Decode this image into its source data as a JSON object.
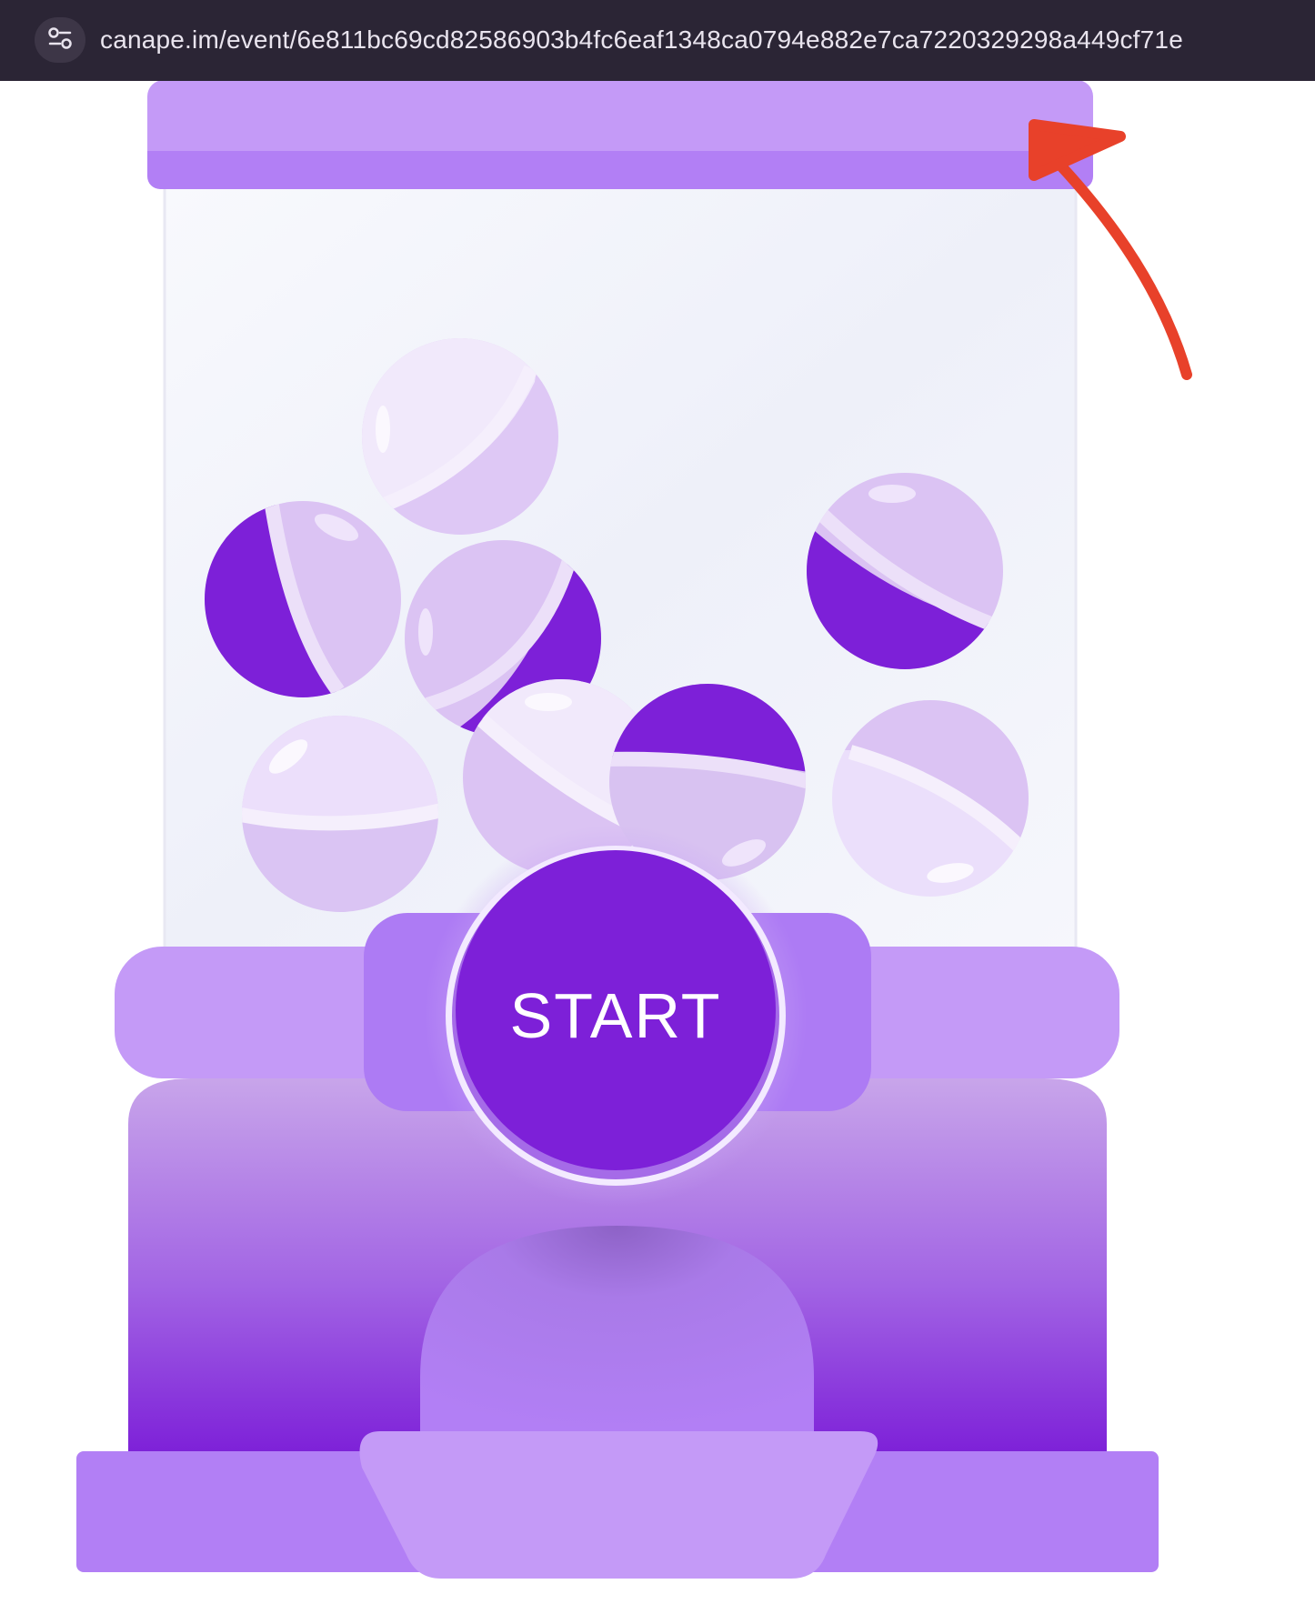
{
  "browser": {
    "url": "canape.im/event/6e811bc69cd82586903b4fc6eaf1348ca0794e882e7ca7220329298a449cf71e",
    "settings_icon": "site-settings-icon"
  },
  "machine": {
    "start_label": "START",
    "colors": {
      "lid": "#c49af7",
      "lid_band": "#b27ff5",
      "body_light": "#c49af7",
      "body_mid": "#b27ff5",
      "accent": "#7d20d8",
      "glass": "#f0f2fa",
      "annotation_arrow": "#e8412a"
    }
  }
}
